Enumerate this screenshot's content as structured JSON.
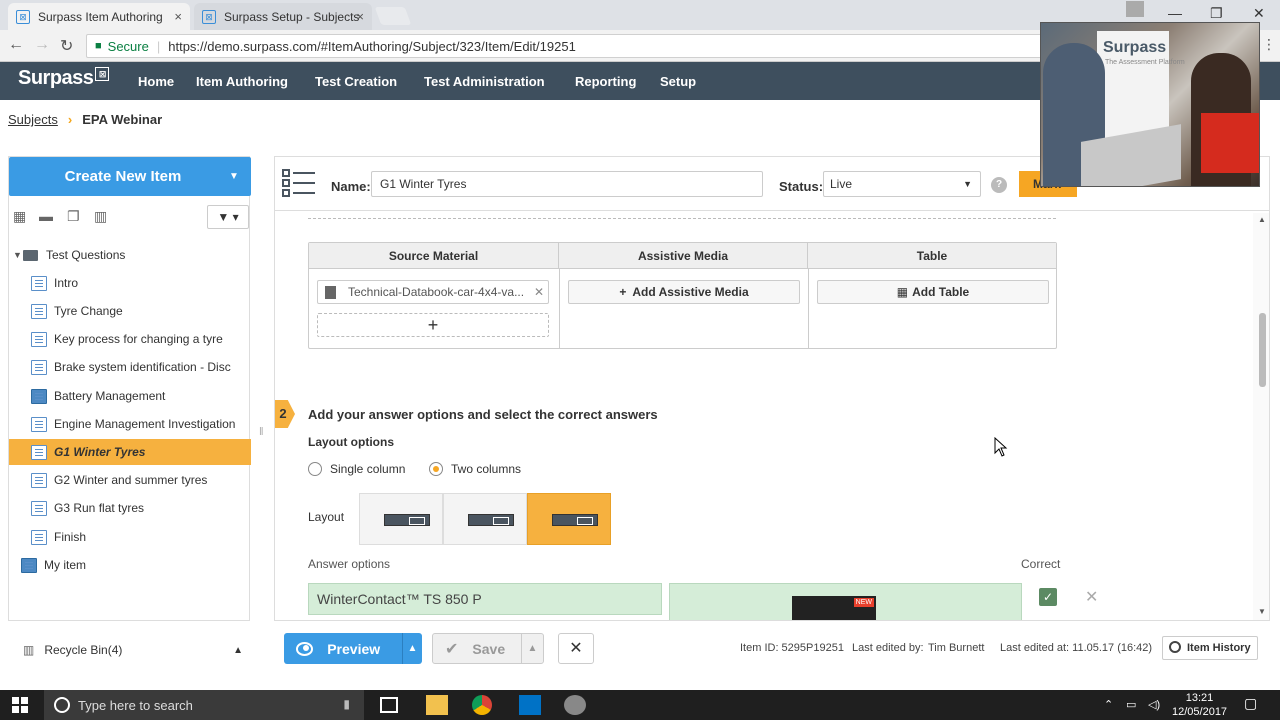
{
  "browser": {
    "tabs": [
      {
        "title": "Surpass Item Authoring",
        "close": "×"
      },
      {
        "title": "Surpass Setup - Subjects",
        "close": "×"
      }
    ],
    "secure_label": "Secure",
    "url": "https://demo.surpass.com/#ItemAuthoring/Subject/323/Item/Edit/19251"
  },
  "app": {
    "logo": "Surpass",
    "nav": [
      "Home",
      "Item Authoring",
      "Test Creation",
      "Test Administration",
      "Reporting",
      "Setup"
    ],
    "active_nav": "Item Authoring"
  },
  "breadcrumb": {
    "parent": "Subjects",
    "current": "EPA Webinar"
  },
  "video": {
    "brand": "Surpass",
    "tagline": "The Assessment Platform"
  },
  "sidebar": {
    "create_label": "Create New Item",
    "root": "Test Questions",
    "items": [
      "Intro",
      "Tyre Change",
      "Key process for changing a tyre",
      "Brake system identification - Disc",
      "Battery Management",
      "Engine Management Investigation",
      "G1 Winter Tyres",
      "G2 Winter and summer tyres",
      "G3 Run flat tyres",
      "Finish"
    ],
    "selected": "G1 Winter Tyres",
    "my_item": "My item",
    "recycle": "Recycle Bin(4)"
  },
  "item": {
    "name_label": "Name:",
    "name_value": "G1 Winter Tyres",
    "status_label": "Status:",
    "status_value": "Live",
    "help": "?",
    "mark_label": "Mark"
  },
  "media": {
    "headers": [
      "Source Material",
      "Assistive Media",
      "Table"
    ],
    "file": "Technical-Databook-car-4x4-va...",
    "add_assistive": "Add Assistive Media",
    "add_table": "Add Table"
  },
  "answers": {
    "step": "2",
    "title": "Add your answer options and select the correct answers",
    "layout_options_label": "Layout options",
    "single_column": "Single column",
    "two_columns": "Two columns",
    "selected_columns": "Two columns",
    "layout_label": "Layout",
    "answer_options_label": "Answer options",
    "correct_label": "Correct",
    "option1": "WinterContact™ TS 850 P",
    "option1_correct": true
  },
  "footer": {
    "preview": "Preview",
    "save": "Save",
    "item_id": "Item ID: 5295P19251",
    "last_edited_by_label": "Last edited by:",
    "last_edited_by": "Tim Burnett",
    "last_edited_at": "Last edited at: 11.05.17 (16:42)",
    "history": "Item History"
  },
  "taskbar": {
    "search_placeholder": "Type here to search",
    "time": "13:21",
    "date": "12/05/2017"
  },
  "colors": {
    "header_bg": "#3e4f5e",
    "accent_orange": "#f6b13f",
    "primary_blue": "#3a9be4",
    "answer_green": "#d5edd8"
  }
}
